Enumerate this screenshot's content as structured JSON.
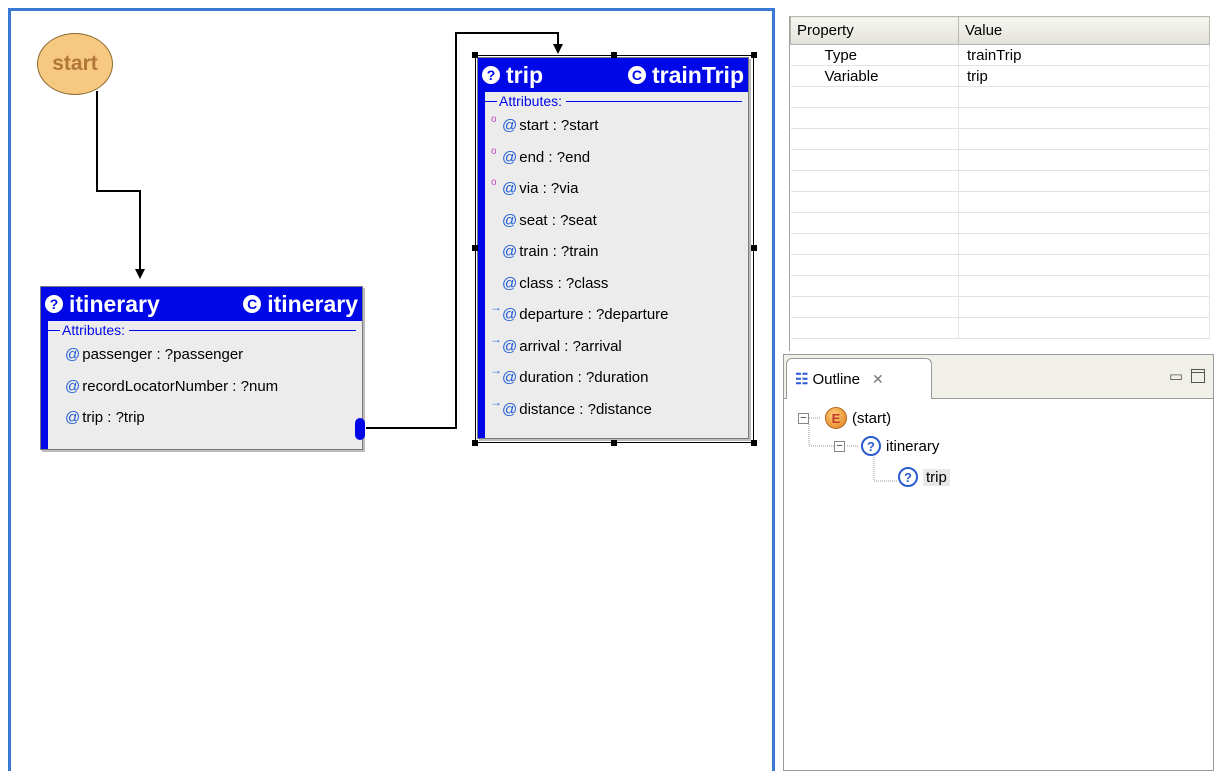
{
  "canvas": {
    "start_label": "start",
    "itinerary_node": {
      "name": "itinerary",
      "type": "itinerary",
      "section": "Attributes:",
      "attributes": [
        "passenger : ?passenger",
        "recordLocatorNumber : ?num",
        "trip : ?trip"
      ]
    },
    "trip_node": {
      "name": "trip",
      "type": "trainTrip",
      "section": "Attributes:",
      "attributes": [
        "start : ?start",
        "end : ?end",
        "via : ?via",
        "seat : ?seat",
        "train : ?train",
        "class : ?class",
        "departure : ?departure",
        "arrival : ?arrival",
        "duration : ?duration",
        "distance : ?distance"
      ]
    }
  },
  "properties": {
    "headers": [
      "Property",
      "Value"
    ],
    "rows": [
      {
        "property": "Type",
        "value": "trainTrip"
      },
      {
        "property": "Variable",
        "value": "trip"
      }
    ]
  },
  "outline": {
    "tab_label": "Outline",
    "tree": [
      {
        "label": "(start)"
      },
      {
        "label": "itinerary"
      },
      {
        "label": "trip"
      }
    ]
  },
  "colors": {
    "node_header": "#0008e8",
    "canvas_border": "#3a78d6",
    "start_fill": "#f7c880"
  }
}
